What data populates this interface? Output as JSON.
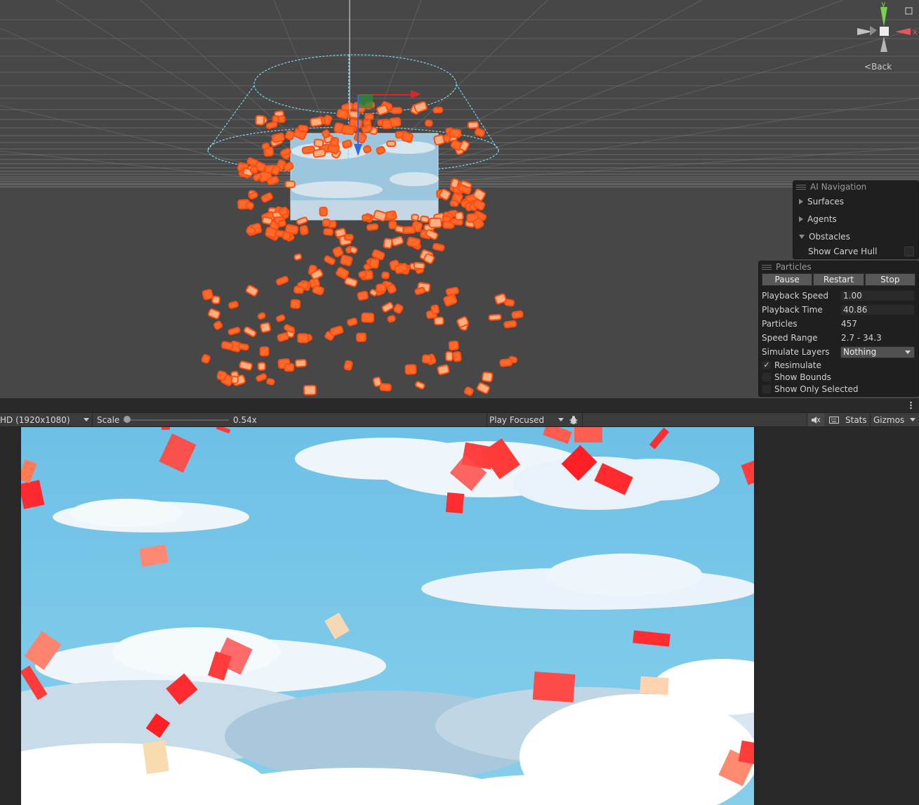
{
  "scene": {
    "gizmo": {
      "back_label": "Back",
      "axis_x": "x",
      "axis_y": "y"
    }
  },
  "ai_navigation": {
    "title": "AI Navigation",
    "items": [
      {
        "label": "Surfaces",
        "expanded": false
      },
      {
        "label": "Agents",
        "expanded": false
      },
      {
        "label": "Obstacles",
        "expanded": true
      }
    ],
    "show_carve_hull": {
      "label": "Show Carve Hull",
      "checked": false
    }
  },
  "particles": {
    "title": "Particles",
    "buttons": {
      "pause": "Pause",
      "restart": "Restart",
      "stop": "Stop"
    },
    "playback_speed": {
      "label": "Playback Speed",
      "value": "1.00"
    },
    "playback_time": {
      "label": "Playback Time",
      "value": "40.86"
    },
    "count": {
      "label": "Particles",
      "value": "457"
    },
    "speed_range": {
      "label": "Speed Range",
      "value": "2.7 - 34.3"
    },
    "simulate_layers": {
      "label": "Simulate Layers",
      "value": "Nothing"
    },
    "resimulate": {
      "label": "Resimulate",
      "checked": true
    },
    "show_bounds": {
      "label": "Show Bounds",
      "checked": false
    },
    "show_only_selected": {
      "label": "Show Only Selected",
      "checked": false
    }
  },
  "game_toolbar": {
    "resolution": "HD (1920x1080)",
    "scale_label": "Scale",
    "scale_value": "0.54x",
    "play_mode": "Play Focused",
    "stats": "Stats",
    "gizmos": "Gizmos"
  },
  "colors": {
    "scene_bg": "#474747",
    "editor_bg": "#282828",
    "sky": "#72c3e6",
    "particle_red": "#ff3a35",
    "particle_orange": "#ff5a1a",
    "selection_outline": "#7fd3e6"
  }
}
